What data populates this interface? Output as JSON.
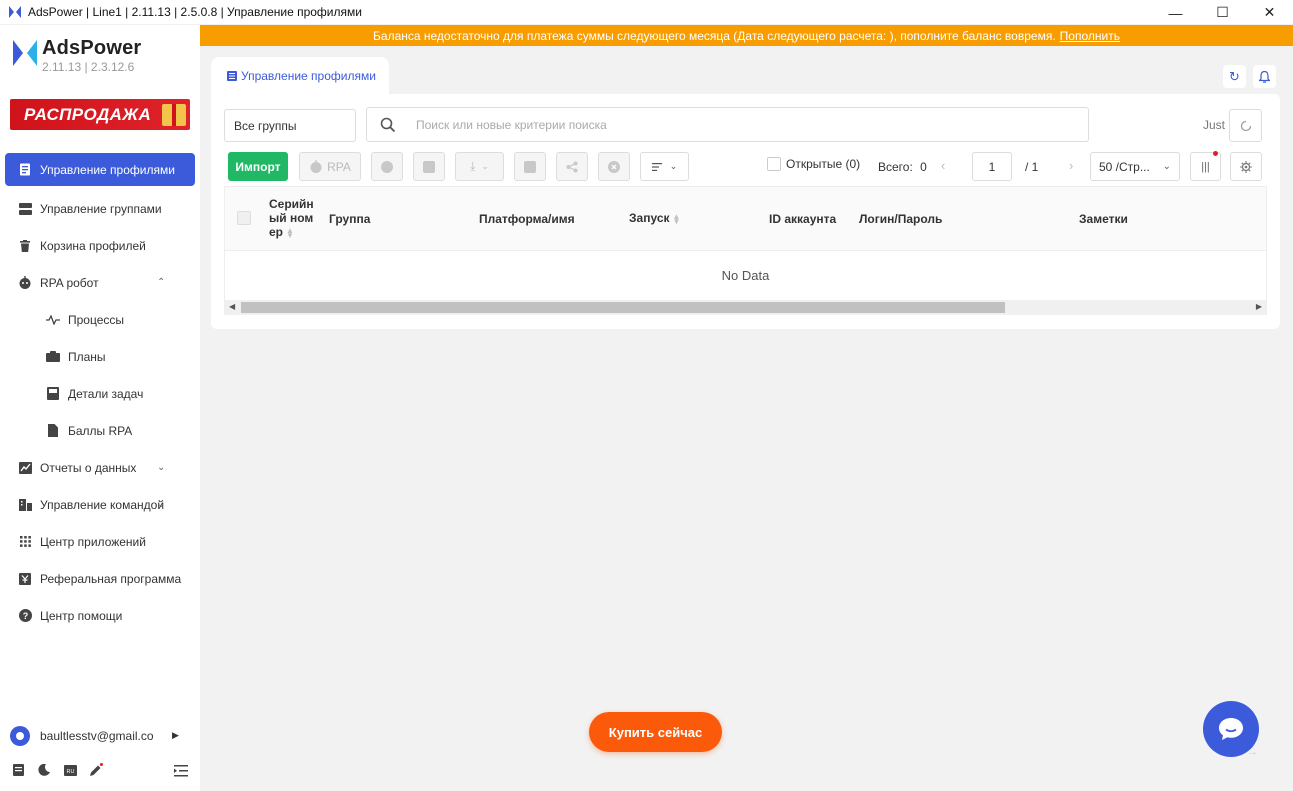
{
  "window": {
    "title": "AdsPower | Line1 | 2.11.13 | 2.5.0.8 | Управление профилями",
    "minimize": "—",
    "maximize": "☐",
    "close": "✕"
  },
  "brand": {
    "name": "AdsPower",
    "version": "2.11.13  |  2.3.12.6",
    "sale_label": "РАСПРОДАЖА",
    "accent": "#3b5bdb"
  },
  "sidebar": {
    "items": [
      {
        "label": "Управление профилями",
        "icon": "profiles-icon",
        "active": true
      },
      {
        "label": "Управление группами",
        "icon": "groups-icon"
      },
      {
        "label": "Корзина профилей",
        "icon": "trash-icon"
      },
      {
        "label": "RPA робот",
        "icon": "robot-icon",
        "caret": "⌃"
      },
      {
        "label": "Процессы",
        "icon": "process-icon",
        "sub": true
      },
      {
        "label": "Планы",
        "icon": "plans-icon",
        "sub": true
      },
      {
        "label": "Детали задач",
        "icon": "task-details-icon",
        "sub": true
      },
      {
        "label": "Баллы RPA",
        "icon": "rpa-points-icon",
        "sub": true
      },
      {
        "label": "Отчеты о данных",
        "icon": "reports-icon",
        "caret": "⌄"
      },
      {
        "label": "Управление командой",
        "icon": "team-icon",
        "caret": "⌄"
      },
      {
        "label": "Центр приложений",
        "icon": "apps-icon"
      },
      {
        "label": "Реферальная программа",
        "icon": "referral-icon"
      },
      {
        "label": "Центр помощи",
        "icon": "help-icon"
      }
    ],
    "user_email": "baultlesstv@gmail.co",
    "lang": "RU"
  },
  "banner": {
    "text": "Баланса недостаточно для платежа суммы следующего месяца (Дата следующего расчета: ), пополните баланс вовремя.",
    "link": "Пополнить",
    "color": "#f79d00"
  },
  "tab": {
    "label": "Управление профилями"
  },
  "filters": {
    "group_select": "Все группы",
    "search_placeholder": "Поиск или новые критерии поиска",
    "just_label": "Just"
  },
  "toolbar": {
    "import_label": "Импорт",
    "rpa_label": "RPA",
    "opened_label": "Открытые (0)",
    "total_label": "Всего:",
    "total_value": "0",
    "page_current": "1",
    "page_total": "/  1",
    "per_page": "50 /Стр...",
    "import_color": "#20b765"
  },
  "table": {
    "columns": [
      "Серийн ый ном ер",
      "Группа",
      "Платформа/имя",
      "Запуск",
      "ID аккаунта",
      "Логин/Пароль",
      "Заметки"
    ],
    "empty_text": "No Data"
  },
  "cta": {
    "buy_label": "Купить сейчас",
    "buy_color": "#fa5a0a"
  }
}
